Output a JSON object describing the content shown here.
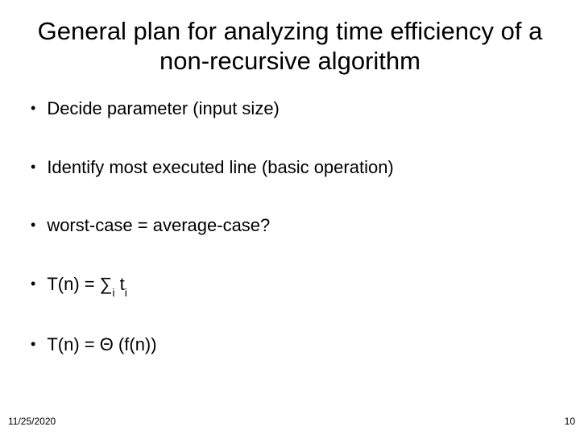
{
  "title": "General plan for analyzing time efficiency of a non-recursive algorithm",
  "bullets": {
    "b0": "Decide parameter (input size)",
    "b1": "Identify most executed line (basic operation)",
    "b2": "worst-case = average-case?",
    "b3_prefix": "T(n) = ",
    "b3_sum": "∑",
    "b3_sub1": "i",
    "b3_mid": " t",
    "b3_sub2": "i",
    "b4": "T(n) = Θ (f(n))"
  },
  "footer": {
    "date": "11/25/2020",
    "page": "10"
  }
}
